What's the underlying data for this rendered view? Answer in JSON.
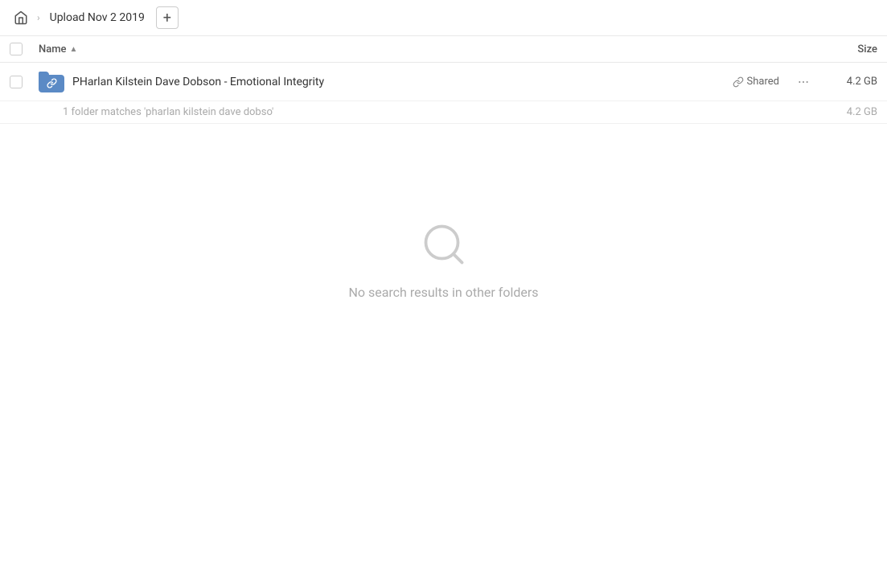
{
  "breadcrumb": {
    "home_icon": "🏠",
    "separator": "›",
    "label": "Upload Nov 2 2019",
    "add_button_label": "+"
  },
  "column_headers": {
    "name_label": "Name",
    "size_label": "Size",
    "sort_indicator": "▲"
  },
  "file_row": {
    "name": "PHarlan Kilstein Dave Dobson - Emotional Integrity",
    "shared_label": "Shared",
    "more_icon": "···",
    "size": "4.2 GB",
    "link_icon": "🔗"
  },
  "match_info": {
    "text": "1 folder matches 'pharlan kilstein dave dobso'",
    "size": "4.2 GB"
  },
  "empty_state": {
    "message": "No search results in other folders"
  },
  "colors": {
    "folder_blue": "#5b8ac5",
    "accent": "#5b8ac5"
  }
}
